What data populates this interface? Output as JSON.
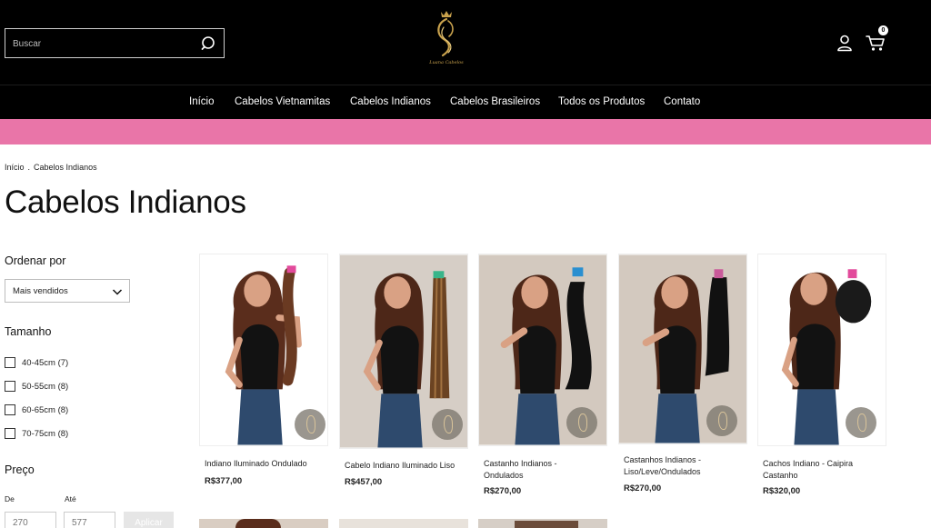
{
  "header": {
    "search_placeholder": "Buscar",
    "logo_text": "Luana Cabelos",
    "cart_count": "0"
  },
  "nav": [
    "Início",
    "Cabelos Vietnamitas",
    "Cabelos Indianos",
    "Cabelos Brasileiros",
    "Todos os Produtos",
    "Contato"
  ],
  "breadcrumb": {
    "home": "Início",
    "sep": ".",
    "current": "Cabelos Indianos"
  },
  "page_title": "Cabelos Indianos",
  "filters": {
    "sort_heading": "Ordenar por",
    "sort_value": "Mais vendidos",
    "size_heading": "Tamanho",
    "sizes": [
      "40-45cm (7)",
      "50-55cm (8)",
      "60-65cm (8)",
      "70-75cm (8)"
    ],
    "price_heading": "Preço",
    "from_label": "De",
    "to_label": "Até",
    "min_placeholder": "270",
    "max_placeholder": "577",
    "apply_label": "Aplicar"
  },
  "products": [
    {
      "name": "Indiano Iluminado Ondulado",
      "price": "R$377,00"
    },
    {
      "name": "Cabelo Indiano Iluminado Liso",
      "price": "R$457,00"
    },
    {
      "name": "Castanho Indianos - Ondulados",
      "price": "R$270,00"
    },
    {
      "name": "Castanhos Indianos - Liso/Leve/Ondulados",
      "price": "R$270,00"
    },
    {
      "name": "Cachos Indiano - Caipira Castanho",
      "price": "R$320,00"
    }
  ],
  "colors": {
    "promo_bar": "#e975a8",
    "header_bg": "#000000",
    "logo_gold": "#c9a24d"
  }
}
